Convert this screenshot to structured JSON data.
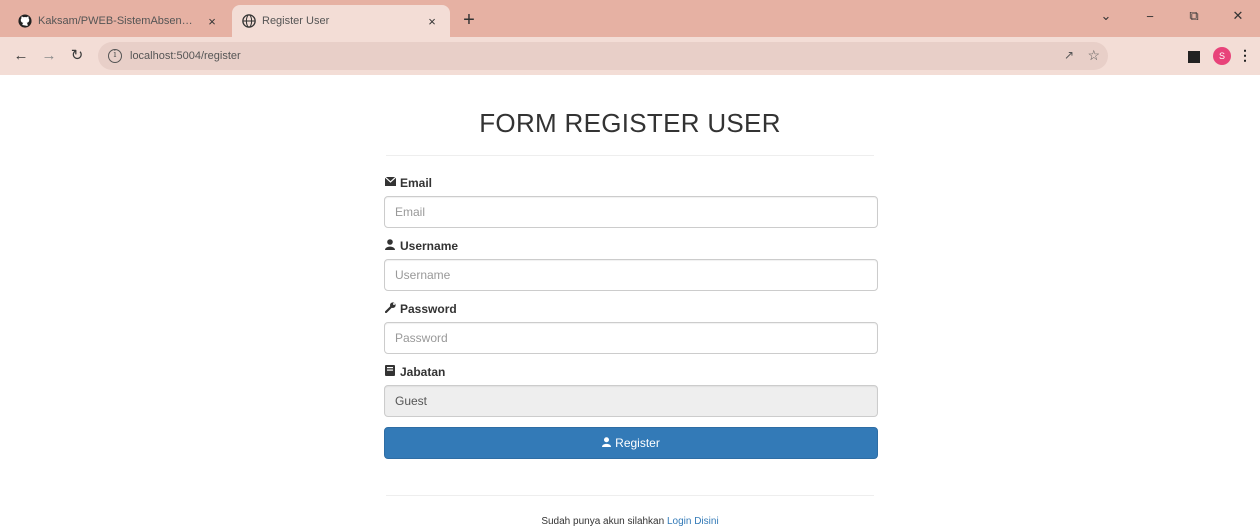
{
  "browser": {
    "tabs": [
      {
        "title": "Kaksam/PWEB-SistemAbsensi/...",
        "icon": "github-icon",
        "active": false
      },
      {
        "title": "Register User",
        "icon": "globe-icon",
        "active": true
      }
    ],
    "close_glyph": "×",
    "newtab_glyph": "+",
    "url": "localhost:5004/register",
    "profile_initial": "S",
    "colors": {
      "tabstrip": "#e6b1a3",
      "toolbar": "#f3ddd6",
      "profile": "#e8437a"
    }
  },
  "form": {
    "title": "FORM REGISTER USER",
    "fields": [
      {
        "label": "Email",
        "icon": "envelope-icon",
        "placeholder": "Email",
        "value": ""
      },
      {
        "label": "Username",
        "icon": "user-icon",
        "placeholder": "Username",
        "value": ""
      },
      {
        "label": "Password",
        "icon": "wrench-icon",
        "placeholder": "Password",
        "value": ""
      },
      {
        "label": "Jabatan",
        "icon": "book-icon",
        "placeholder": "",
        "value": "Guest"
      }
    ],
    "submit_label": "Register",
    "submit_color": "#337ab7"
  },
  "footer": {
    "text": "Sudah punya akun silahkan",
    "link_label": "Login Disini"
  }
}
